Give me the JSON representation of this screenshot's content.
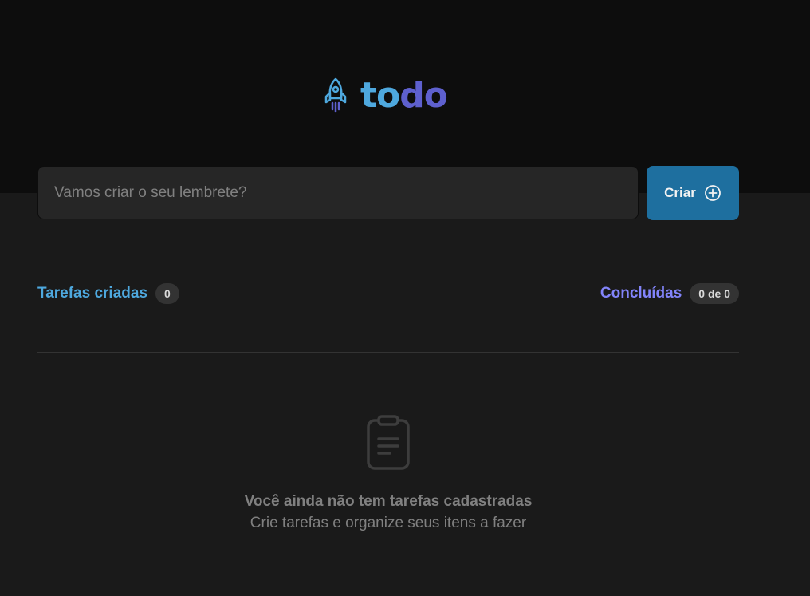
{
  "header": {
    "logo_icon": "rocket-icon",
    "logo_part1": "to",
    "logo_part2": "do"
  },
  "create": {
    "placeholder": "Vamos criar o seu lembrete?",
    "value": "",
    "button_label": "Criar",
    "button_icon": "plus-circle-icon"
  },
  "counters": {
    "created_label": "Tarefas criadas",
    "created_count": "0",
    "done_label": "Concluídas",
    "done_count": "0 de 0"
  },
  "empty_state": {
    "icon": "clipboard-icon",
    "title": "Você ainda não tem tarefas cadastradas",
    "subtitle": "Crie tarefas e organize seus itens a fazer"
  },
  "colors": {
    "header_bg": "#0d0d0d",
    "page_bg": "#1a1a1a",
    "input_bg": "#262626",
    "blue": "#4ea8de",
    "blue_dark": "#1e6f9f",
    "purple": "#8284fa",
    "purple_dark": "#5e60ce",
    "gray_300": "#808080"
  }
}
